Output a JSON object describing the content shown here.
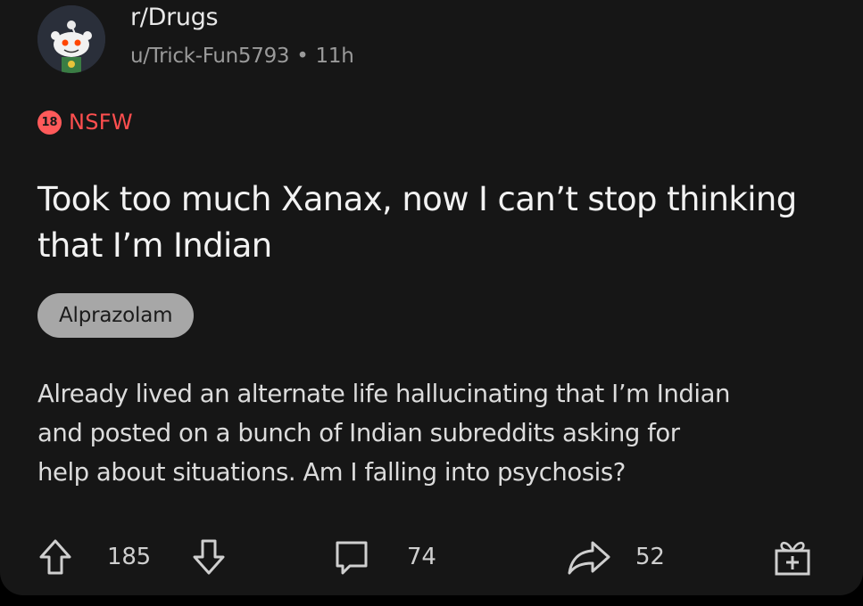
{
  "post": {
    "subreddit": "r/Drugs",
    "author": "u/Trick-Fun5793",
    "separator": "•",
    "age": "11h",
    "nsfw": {
      "badge_number": "18",
      "label": "NSFW",
      "color": "#ff4f4f"
    },
    "title": "Took too much Xanax, now I can’t stop thinking that I’m Indian",
    "flair": "Alprazolam",
    "body_lines": [
      "Already lived an alternate life hallucinating that I’m Indian",
      "and posted on a bunch of Indian subreddits asking for",
      "help about situations. Am I falling into psychosis?"
    ]
  },
  "actions": {
    "upvote_icon": "arrow-up-icon",
    "vote_count": "185",
    "downvote_icon": "arrow-down-icon",
    "comment_icon": "comment-bubble-icon",
    "comment_count": "74",
    "share_icon": "share-arrow-icon",
    "share_count": "52",
    "award_icon": "gift-award-icon"
  },
  "colors": {
    "background": "#161616",
    "text_primary": "#f2f2f2",
    "text_secondary": "#9a9a9a",
    "flair_bg": "#a7a7a7"
  }
}
